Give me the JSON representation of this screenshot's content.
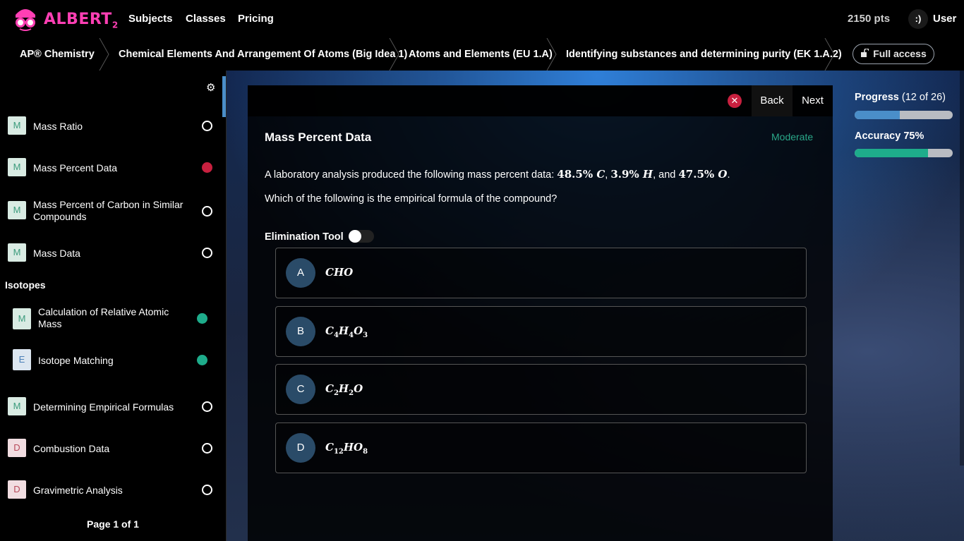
{
  "brand": {
    "name": "ALBERT",
    "sub": "2",
    "logo_icon": "glasses-mascot-icon"
  },
  "nav": {
    "subjects": "Subjects",
    "classes": "Classes",
    "pricing": "Pricing"
  },
  "account": {
    "points": "2150 pts",
    "avatar": ":)",
    "user": "User"
  },
  "breadcrumb": {
    "items": [
      "AP® Chemistry",
      "Chemical Elements And Arrangement Of Atoms (Big Idea 1)",
      "Atoms and Elements (EU 1.A)",
      "Identifying substances and determining purity (EK 1.A.2)"
    ],
    "full_access": "Full access"
  },
  "sidebar": {
    "settings_icon": "gear-icon",
    "items": [
      {
        "badge": "M",
        "label": "Mass Ratio",
        "status": "empty"
      },
      {
        "badge": "M",
        "label": "Mass Percent Data",
        "status": "current"
      },
      {
        "badge": "M",
        "label": "Mass Percent of Carbon in Similar Compounds",
        "status": "empty"
      },
      {
        "badge": "M",
        "label": "Mass Data",
        "status": "empty"
      },
      {
        "badge": "M",
        "label": "Calculation of Relative Atomic Mass",
        "status": "correct"
      },
      {
        "badge": "E",
        "label": "Isotope Matching",
        "status": "correct"
      },
      {
        "badge": "M",
        "label": "Determining Empirical Formulas",
        "status": "empty"
      },
      {
        "badge": "D",
        "label": "Combustion Data",
        "status": "empty"
      },
      {
        "badge": "D",
        "label": "Gravimetric Analysis",
        "status": "empty"
      }
    ],
    "section_isotopes": "Isotopes",
    "pager": "Page 1 of 1"
  },
  "question": {
    "close_icon": "close-icon",
    "back": "Back",
    "next": "Next",
    "title": "Mass Percent Data",
    "difficulty": "Moderate",
    "prompt_prefix": "A laboratory analysis produced the following mass percent data: ",
    "m1": "48.5% ",
    "e1": "C",
    "sep1": ", ",
    "m2": "3.9% ",
    "e2": "H",
    "sep2": ", and ",
    "m3": "47.5% ",
    "e3": "O",
    "end": ".",
    "prompt2": "Which of the following is the empirical formula of the compound?",
    "elimination_tool": "Elimination Tool",
    "elimination_on": false,
    "choices": [
      {
        "letter": "A",
        "formula": "CHO"
      },
      {
        "letter": "B",
        "formula": "C4H4O3"
      },
      {
        "letter": "C",
        "formula": "C2H2O"
      },
      {
        "letter": "D",
        "formula": "C12HO8"
      }
    ]
  },
  "stats": {
    "progress_label": "Progress",
    "progress_count": "(12 of 26)",
    "progress_fraction": 0.4615,
    "progress_color": "#4a8ec9",
    "accuracy_label": "Accuracy 75%",
    "accuracy_fraction": 0.75,
    "accuracy_color": "#1eac8b"
  },
  "colors": {
    "accent_red": "#c8203f",
    "accent_green": "#1eac8b",
    "brand_pink": "#ff3fb4"
  }
}
